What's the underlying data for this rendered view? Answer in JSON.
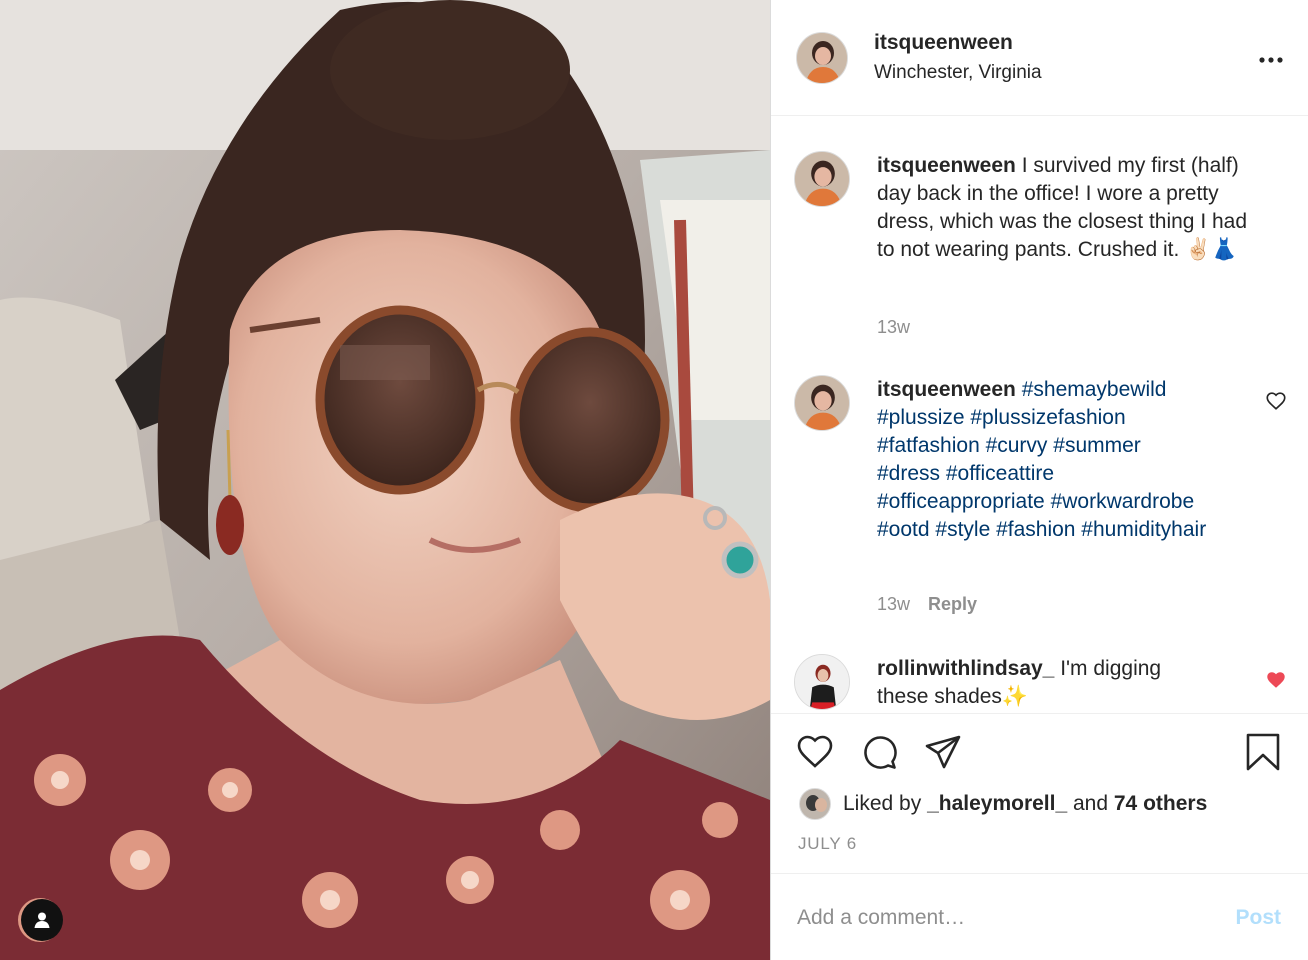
{
  "post": {
    "author": "itsqueenween",
    "location": "Winchester, Virginia"
  },
  "comments": [
    {
      "author": "itsqueenween",
      "text": " I survived my first (half) day back in the office! I wore a pretty dress, which was the closest thing I had to not wearing pants. Crushed it. ✌🏻👗",
      "age": "13w"
    },
    {
      "author": "itsqueenween",
      "hashtags": " #shemaybewild #plussize #plussizefashion #fatfashion #curvy #summer #dress #officeattire #officeappropriate #workwardrobe #ootd #style #fashion #humidityhair",
      "age": "13w",
      "reply_label": "Reply",
      "liked": false
    },
    {
      "author": "rollinwithlindsay_",
      "text": " I'm digging these shades✨",
      "liked": true
    }
  ],
  "likes": {
    "prefix": "Liked by ",
    "user": "_haleymorell_",
    "middle": " and ",
    "others": "74 others"
  },
  "date": "JULY 6",
  "comment_box": {
    "placeholder": "Add a comment…",
    "post_label": "Post"
  },
  "colors": {
    "text": "#262626",
    "secondary": "#8e8e8e",
    "hashtag": "#00376b",
    "heart_liked": "#ed4956",
    "post_disabled": "#b2dffc",
    "divider": "#efefef"
  },
  "icons": [
    "heart-icon",
    "comment-icon",
    "share-icon",
    "bookmark-icon",
    "more-icon",
    "user-tag-icon"
  ]
}
